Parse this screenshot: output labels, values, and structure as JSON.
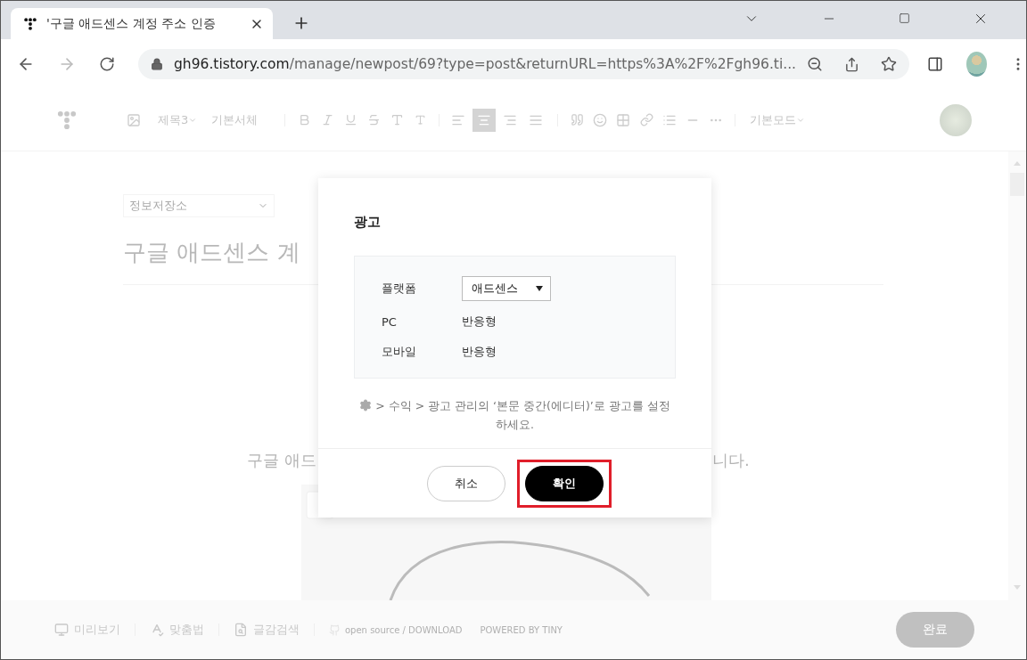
{
  "browser": {
    "tab": {
      "title": "'구글 애드센스 계정 주소 인증"
    },
    "url": {
      "host": "gh96.tistory.com",
      "path": "/manage/newpost/69?type=post&returnURL=https%3A%2F%2Fgh96.ti..."
    },
    "forward_disabled": true
  },
  "editor": {
    "toolbar": {
      "heading": "제목3",
      "font": "기본서체",
      "align": [
        {
          "kind": "left",
          "selected": false
        },
        {
          "kind": "center",
          "selected": true
        },
        {
          "kind": "right",
          "selected": false
        },
        {
          "kind": "justify",
          "selected": false
        }
      ],
      "mode": "기본모드"
    },
    "category": "정보저장소",
    "title": "구글 애드센스 계",
    "body_left": "구글 애드",
    "body_right": "니다."
  },
  "footer": {
    "tools": [
      {
        "kind": "preview",
        "label": "미리보기"
      },
      {
        "kind": "spelling",
        "label": "맞춤법"
      },
      {
        "kind": "search",
        "label": "글감검색"
      }
    ],
    "open_source": "open source / DOWNLOAD",
    "powered": "POWERED BY TINY",
    "done": "완료"
  },
  "dialog": {
    "title": "광고",
    "rows": [
      {
        "kind": "select",
        "label": "플랫폼",
        "value": "애드센스"
      },
      {
        "kind": "text",
        "label": "PC",
        "value": "반응형"
      },
      {
        "kind": "text",
        "label": "모바일",
        "value": "반응형"
      }
    ],
    "note": "> 수익 > 광고 관리의 ‘본문 중간(에디터)’로 광고를 설정하세요.",
    "buttons": [
      {
        "kind": "cancel",
        "label": "취소",
        "highlighted": false
      },
      {
        "kind": "confirm",
        "label": "확인",
        "highlighted": true
      }
    ]
  }
}
